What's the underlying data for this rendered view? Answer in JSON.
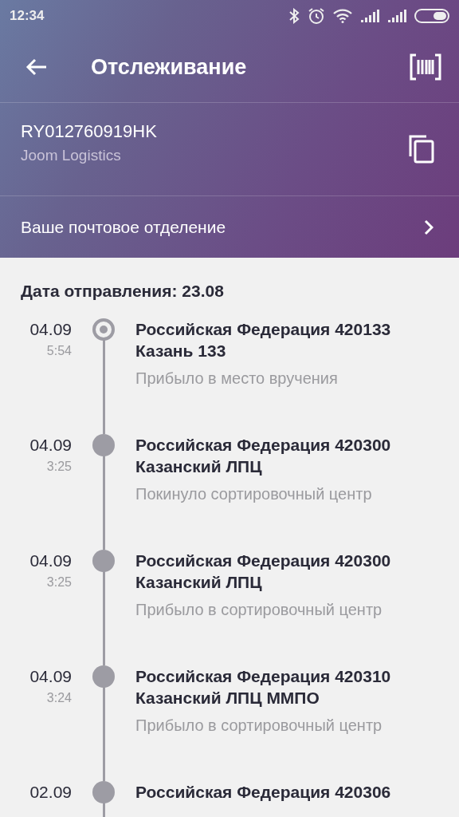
{
  "status_bar": {
    "time": "12:34"
  },
  "app_bar": {
    "title": "Отслеживание"
  },
  "parcel": {
    "tracking_number": "RY012760919HK",
    "carrier": "Joom Logistics"
  },
  "post_office": {
    "label": "Ваше почтовое отделение"
  },
  "shipped": {
    "label": "Дата отправления: 23.08"
  },
  "events": [
    {
      "date": "04.09",
      "time": "5:54",
      "title": "Российская Федерация 420133 Казань 133",
      "status": "Прибыло в место вручения",
      "current": true
    },
    {
      "date": "04.09",
      "time": "3:25",
      "title": "Российская Федерация 420300 Казанский ЛПЦ",
      "status": "Покинуло сортировочный центр",
      "current": false
    },
    {
      "date": "04.09",
      "time": "3:25",
      "title": "Российская Федерация 420300 Казанский ЛПЦ",
      "status": "Прибыло в сортировочный центр",
      "current": false
    },
    {
      "date": "04.09",
      "time": "3:24",
      "title": "Российская Федерация 420310 Казанский ЛПЦ ММПО",
      "status": "Прибыло в сортировочный центр",
      "current": false
    },
    {
      "date": "02.09",
      "title": "Российская Федерация 420306",
      "current": false
    }
  ]
}
